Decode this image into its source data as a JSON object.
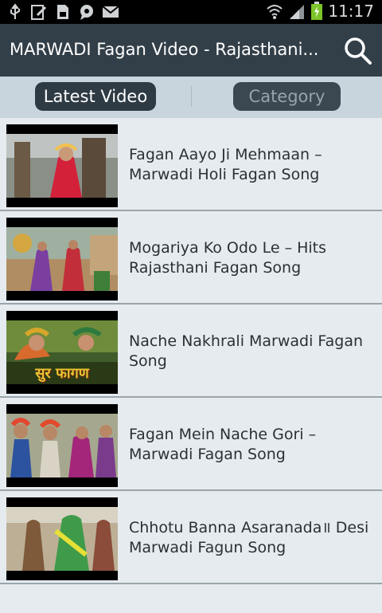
{
  "status_bar": {
    "time": "11:17",
    "left_icons": [
      "usb-icon",
      "screen-edit-icon",
      "sd-card-icon",
      "chat-icon",
      "gmail-icon"
    ],
    "right_icons": [
      "wifi-icon",
      "signal-icon",
      "battery-icon"
    ]
  },
  "app_bar": {
    "title": "MARWADI Fagan Video - Rajasthani...",
    "search_icon": "search-icon"
  },
  "tabs": {
    "latest": "Latest Video",
    "category": "Category"
  },
  "videos": [
    {
      "title": "Fagan Aayo Ji Mehmaan – Marwadi Holi Fagan Song"
    },
    {
      "title": "Mogariya Ko Odo Le – Hits Rajasthani Fagan Song"
    },
    {
      "title": "Nache Nakhrali Marwadi Fagan Song"
    },
    {
      "title": "Fagan Mein Nache Gori – Marwadi Fagan Song"
    },
    {
      "title": "Chhotu Banna Asaranada॥ Desi Marwadi Fagun Song"
    }
  ],
  "thumbnail_overlay_text": "सुर फागण",
  "colors": {
    "app_bar": "#333f48",
    "tab_bar": "#c9d5dd",
    "list_bg": "#e6ebef",
    "battery": "#7cc42a"
  }
}
